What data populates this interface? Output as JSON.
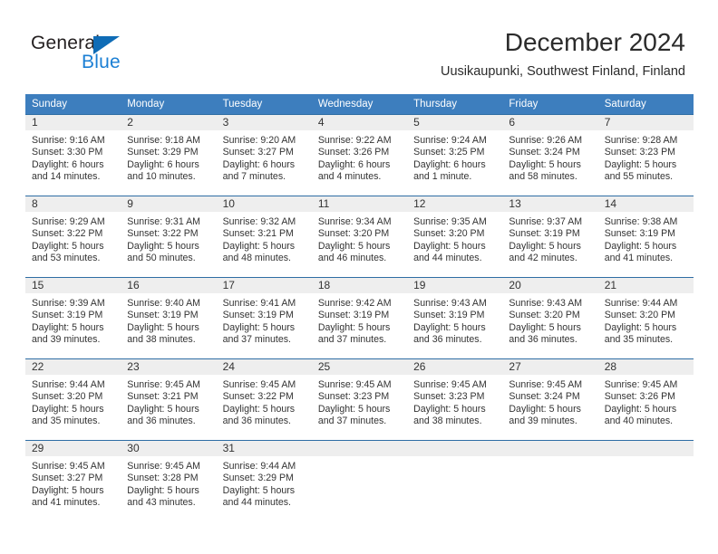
{
  "brand": {
    "name_part1": "General",
    "name_part2": "Blue",
    "triangle_color": "#0f6cb6",
    "blue_text_color": "#1b7fd4"
  },
  "header": {
    "title": "December 2024",
    "location": "Uusikaupunki, Southwest Finland, Finland"
  },
  "theme": {
    "header_blue": "#3d7ebe",
    "row_divider_blue": "#2e6da4",
    "daynum_band_gray": "#eeeeee",
    "text_color": "#333333"
  },
  "calendar": {
    "weekday_headers": [
      "Sunday",
      "Monday",
      "Tuesday",
      "Wednesday",
      "Thursday",
      "Friday",
      "Saturday"
    ],
    "weeks": [
      [
        {
          "day": "1",
          "sunrise": "Sunrise: 9:16 AM",
          "sunset": "Sunset: 3:30 PM",
          "daylight_line1": "Daylight: 6 hours",
          "daylight_line2": "and 14 minutes."
        },
        {
          "day": "2",
          "sunrise": "Sunrise: 9:18 AM",
          "sunset": "Sunset: 3:29 PM",
          "daylight_line1": "Daylight: 6 hours",
          "daylight_line2": "and 10 minutes."
        },
        {
          "day": "3",
          "sunrise": "Sunrise: 9:20 AM",
          "sunset": "Sunset: 3:27 PM",
          "daylight_line1": "Daylight: 6 hours",
          "daylight_line2": "and 7 minutes."
        },
        {
          "day": "4",
          "sunrise": "Sunrise: 9:22 AM",
          "sunset": "Sunset: 3:26 PM",
          "daylight_line1": "Daylight: 6 hours",
          "daylight_line2": "and 4 minutes."
        },
        {
          "day": "5",
          "sunrise": "Sunrise: 9:24 AM",
          "sunset": "Sunset: 3:25 PM",
          "daylight_line1": "Daylight: 6 hours",
          "daylight_line2": "and 1 minute."
        },
        {
          "day": "6",
          "sunrise": "Sunrise: 9:26 AM",
          "sunset": "Sunset: 3:24 PM",
          "daylight_line1": "Daylight: 5 hours",
          "daylight_line2": "and 58 minutes."
        },
        {
          "day": "7",
          "sunrise": "Sunrise: 9:28 AM",
          "sunset": "Sunset: 3:23 PM",
          "daylight_line1": "Daylight: 5 hours",
          "daylight_line2": "and 55 minutes."
        }
      ],
      [
        {
          "day": "8",
          "sunrise": "Sunrise: 9:29 AM",
          "sunset": "Sunset: 3:22 PM",
          "daylight_line1": "Daylight: 5 hours",
          "daylight_line2": "and 53 minutes."
        },
        {
          "day": "9",
          "sunrise": "Sunrise: 9:31 AM",
          "sunset": "Sunset: 3:22 PM",
          "daylight_line1": "Daylight: 5 hours",
          "daylight_line2": "and 50 minutes."
        },
        {
          "day": "10",
          "sunrise": "Sunrise: 9:32 AM",
          "sunset": "Sunset: 3:21 PM",
          "daylight_line1": "Daylight: 5 hours",
          "daylight_line2": "and 48 minutes."
        },
        {
          "day": "11",
          "sunrise": "Sunrise: 9:34 AM",
          "sunset": "Sunset: 3:20 PM",
          "daylight_line1": "Daylight: 5 hours",
          "daylight_line2": "and 46 minutes."
        },
        {
          "day": "12",
          "sunrise": "Sunrise: 9:35 AM",
          "sunset": "Sunset: 3:20 PM",
          "daylight_line1": "Daylight: 5 hours",
          "daylight_line2": "and 44 minutes."
        },
        {
          "day": "13",
          "sunrise": "Sunrise: 9:37 AM",
          "sunset": "Sunset: 3:19 PM",
          "daylight_line1": "Daylight: 5 hours",
          "daylight_line2": "and 42 minutes."
        },
        {
          "day": "14",
          "sunrise": "Sunrise: 9:38 AM",
          "sunset": "Sunset: 3:19 PM",
          "daylight_line1": "Daylight: 5 hours",
          "daylight_line2": "and 41 minutes."
        }
      ],
      [
        {
          "day": "15",
          "sunrise": "Sunrise: 9:39 AM",
          "sunset": "Sunset: 3:19 PM",
          "daylight_line1": "Daylight: 5 hours",
          "daylight_line2": "and 39 minutes."
        },
        {
          "day": "16",
          "sunrise": "Sunrise: 9:40 AM",
          "sunset": "Sunset: 3:19 PM",
          "daylight_line1": "Daylight: 5 hours",
          "daylight_line2": "and 38 minutes."
        },
        {
          "day": "17",
          "sunrise": "Sunrise: 9:41 AM",
          "sunset": "Sunset: 3:19 PM",
          "daylight_line1": "Daylight: 5 hours",
          "daylight_line2": "and 37 minutes."
        },
        {
          "day": "18",
          "sunrise": "Sunrise: 9:42 AM",
          "sunset": "Sunset: 3:19 PM",
          "daylight_line1": "Daylight: 5 hours",
          "daylight_line2": "and 37 minutes."
        },
        {
          "day": "19",
          "sunrise": "Sunrise: 9:43 AM",
          "sunset": "Sunset: 3:19 PM",
          "daylight_line1": "Daylight: 5 hours",
          "daylight_line2": "and 36 minutes."
        },
        {
          "day": "20",
          "sunrise": "Sunrise: 9:43 AM",
          "sunset": "Sunset: 3:20 PM",
          "daylight_line1": "Daylight: 5 hours",
          "daylight_line2": "and 36 minutes."
        },
        {
          "day": "21",
          "sunrise": "Sunrise: 9:44 AM",
          "sunset": "Sunset: 3:20 PM",
          "daylight_line1": "Daylight: 5 hours",
          "daylight_line2": "and 35 minutes."
        }
      ],
      [
        {
          "day": "22",
          "sunrise": "Sunrise: 9:44 AM",
          "sunset": "Sunset: 3:20 PM",
          "daylight_line1": "Daylight: 5 hours",
          "daylight_line2": "and 35 minutes."
        },
        {
          "day": "23",
          "sunrise": "Sunrise: 9:45 AM",
          "sunset": "Sunset: 3:21 PM",
          "daylight_line1": "Daylight: 5 hours",
          "daylight_line2": "and 36 minutes."
        },
        {
          "day": "24",
          "sunrise": "Sunrise: 9:45 AM",
          "sunset": "Sunset: 3:22 PM",
          "daylight_line1": "Daylight: 5 hours",
          "daylight_line2": "and 36 minutes."
        },
        {
          "day": "25",
          "sunrise": "Sunrise: 9:45 AM",
          "sunset": "Sunset: 3:23 PM",
          "daylight_line1": "Daylight: 5 hours",
          "daylight_line2": "and 37 minutes."
        },
        {
          "day": "26",
          "sunrise": "Sunrise: 9:45 AM",
          "sunset": "Sunset: 3:23 PM",
          "daylight_line1": "Daylight: 5 hours",
          "daylight_line2": "and 38 minutes."
        },
        {
          "day": "27",
          "sunrise": "Sunrise: 9:45 AM",
          "sunset": "Sunset: 3:24 PM",
          "daylight_line1": "Daylight: 5 hours",
          "daylight_line2": "and 39 minutes."
        },
        {
          "day": "28",
          "sunrise": "Sunrise: 9:45 AM",
          "sunset": "Sunset: 3:26 PM",
          "daylight_line1": "Daylight: 5 hours",
          "daylight_line2": "and 40 minutes."
        }
      ],
      [
        {
          "day": "29",
          "sunrise": "Sunrise: 9:45 AM",
          "sunset": "Sunset: 3:27 PM",
          "daylight_line1": "Daylight: 5 hours",
          "daylight_line2": "and 41 minutes."
        },
        {
          "day": "30",
          "sunrise": "Sunrise: 9:45 AM",
          "sunset": "Sunset: 3:28 PM",
          "daylight_line1": "Daylight: 5 hours",
          "daylight_line2": "and 43 minutes."
        },
        {
          "day": "31",
          "sunrise": "Sunrise: 9:44 AM",
          "sunset": "Sunset: 3:29 PM",
          "daylight_line1": "Daylight: 5 hours",
          "daylight_line2": "and 44 minutes."
        },
        {
          "day": "",
          "sunrise": "",
          "sunset": "",
          "daylight_line1": "",
          "daylight_line2": ""
        },
        {
          "day": "",
          "sunrise": "",
          "sunset": "",
          "daylight_line1": "",
          "daylight_line2": ""
        },
        {
          "day": "",
          "sunrise": "",
          "sunset": "",
          "daylight_line1": "",
          "daylight_line2": ""
        },
        {
          "day": "",
          "sunrise": "",
          "sunset": "",
          "daylight_line1": "",
          "daylight_line2": ""
        }
      ]
    ]
  }
}
